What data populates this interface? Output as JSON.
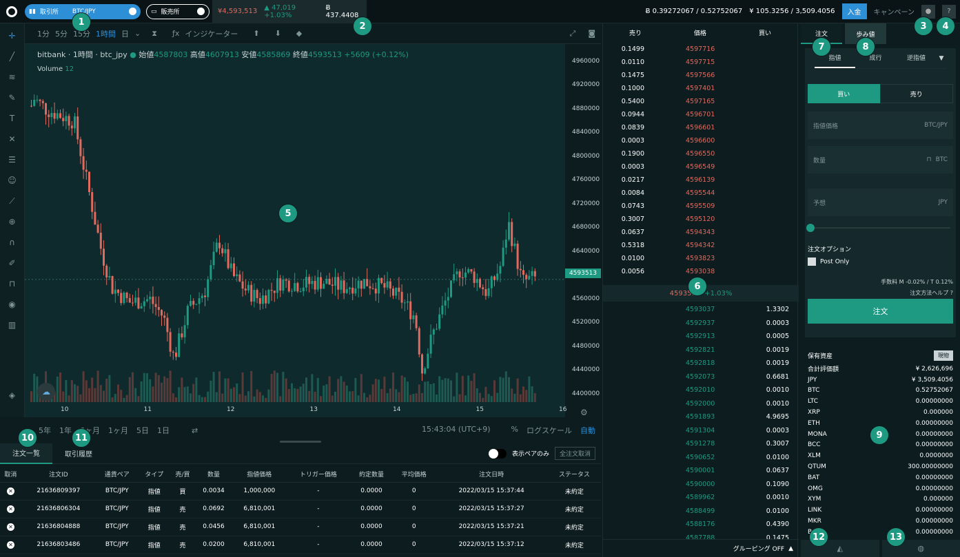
{
  "topbar": {
    "exchange_label": "取引所",
    "pair": "BTC/JPY",
    "shop_label": "販売所",
    "price": "¥4,593,513",
    "change": "47,019 +1.03%",
    "volume": "437.4408",
    "btc_balance": "0.39272067 / 0.52752067",
    "jpy_balance": "¥ 105.3256 / 3,509.4056",
    "deposit": "入金",
    "campaign": "キャンペーン"
  },
  "badges": [
    "1",
    "2",
    "3",
    "4",
    "5",
    "6",
    "7",
    "8",
    "9",
    "10",
    "11",
    "12",
    "13"
  ],
  "chart_header": {
    "intervals": [
      "1分",
      "5分",
      "15分",
      "1時間",
      "日"
    ],
    "active": "1時間",
    "indicator": "インジケーター"
  },
  "legend": {
    "source": "bitbank · 1時間 · btc_jpy",
    "open_label": "始値",
    "open": "4587803",
    "high_label": "高値",
    "high": "4607913",
    "low_label": "安値",
    "low": "4585869",
    "close_label": "終値",
    "close": "4593513",
    "diff": "+5609 (+0.12%)",
    "volume_label": "Volume",
    "volume": "12"
  },
  "chart_data": {
    "type": "candlestick",
    "y_ticks": [
      "4960000",
      "4920000",
      "4880000",
      "4840000",
      "4800000",
      "4760000",
      "4720000",
      "4680000",
      "4640000",
      "4600000",
      "4560000",
      "4520000",
      "4480000",
      "4440000",
      "4400000"
    ],
    "x_ticks": [
      "10",
      "11",
      "12",
      "13",
      "14",
      "15",
      "16"
    ],
    "last_price": "4593513",
    "ylim": [
      4380000,
      4990000
    ]
  },
  "range_bar": {
    "ranges": [
      "5年",
      "1年",
      "6ヶ月",
      "1ヶ月",
      "5日",
      "1日"
    ],
    "time": "15:43:04 (UTC+9)",
    "pct": "%",
    "log": "ログスケール",
    "auto": "自動"
  },
  "orders": {
    "tabs": [
      "注文一覧",
      "取引履歴"
    ],
    "pair_only": "表示ペアのみ",
    "cancel_all": "全注文取消",
    "headers": [
      "取消",
      "注文ID",
      "通貨ペア",
      "タイプ",
      "売/買",
      "数量",
      "指値価格",
      "トリガー価格",
      "約定数量",
      "平均価格",
      "注文日時",
      "ステータス"
    ],
    "rows": [
      {
        "id": "21636809397",
        "pair": "BTC/JPY",
        "type": "指値",
        "side": "買",
        "qty": "0.0034",
        "price": "1,000,000",
        "trigger": "-",
        "filled": "0.0000",
        "avg": "0",
        "date": "2022/03/15 15:37:44",
        "status": "未約定"
      },
      {
        "id": "21636806304",
        "pair": "BTC/JPY",
        "type": "指値",
        "side": "売",
        "qty": "0.0692",
        "price": "6,810,001",
        "trigger": "-",
        "filled": "0.0000",
        "avg": "0",
        "date": "2022/03/15 15:37:27",
        "status": "未約定"
      },
      {
        "id": "21636804888",
        "pair": "BTC/JPY",
        "type": "指値",
        "side": "売",
        "qty": "0.0456",
        "price": "6,810,001",
        "trigger": "-",
        "filled": "0.0000",
        "avg": "0",
        "date": "2022/03/15 15:37:21",
        "status": "未約定"
      },
      {
        "id": "21636803486",
        "pair": "BTC/JPY",
        "type": "指値",
        "side": "売",
        "qty": "0.0200",
        "price": "6,810,001",
        "trigger": "-",
        "filled": "0.0000",
        "avg": "0",
        "date": "2022/03/15 15:37:12",
        "status": "未約定"
      }
    ]
  },
  "orderbook": {
    "headers": [
      "売り",
      "価格",
      "買い"
    ],
    "asks": [
      [
        "0.1499",
        "4597716"
      ],
      [
        "0.0110",
        "4597715"
      ],
      [
        "0.1475",
        "4597566"
      ],
      [
        "0.1000",
        "4597401"
      ],
      [
        "0.5400",
        "4597165"
      ],
      [
        "0.0944",
        "4596701"
      ],
      [
        "0.0839",
        "4596601"
      ],
      [
        "0.0003",
        "4596600"
      ],
      [
        "0.1900",
        "4596550"
      ],
      [
        "0.0003",
        "4596549"
      ],
      [
        "0.0217",
        "4596139"
      ],
      [
        "0.0084",
        "4595544"
      ],
      [
        "0.0743",
        "4595509"
      ],
      [
        "0.3007",
        "4595120"
      ],
      [
        "0.0637",
        "4594343"
      ],
      [
        "0.5318",
        "4594342"
      ],
      [
        "0.0100",
        "4593823"
      ],
      [
        "0.0056",
        "4593038"
      ]
    ],
    "mid_price": "4593513",
    "mid_change": "+1.03%",
    "bids": [
      [
        "4593037",
        "1.3302"
      ],
      [
        "4592937",
        "0.0003"
      ],
      [
        "4592913",
        "0.0005"
      ],
      [
        "4592821",
        "0.0019"
      ],
      [
        "4592818",
        "0.0019"
      ],
      [
        "4592073",
        "0.6681"
      ],
      [
        "4592010",
        "0.0010"
      ],
      [
        "4592000",
        "0.0010"
      ],
      [
        "4591893",
        "4.9695"
      ],
      [
        "4591304",
        "0.0003"
      ],
      [
        "4591278",
        "0.3007"
      ],
      [
        "4590652",
        "0.0100"
      ],
      [
        "4590001",
        "0.0637"
      ],
      [
        "4590000",
        "0.1090"
      ],
      [
        "4589962",
        "0.0010"
      ],
      [
        "4588499",
        "0.0100"
      ],
      [
        "4588176",
        "0.4390"
      ],
      [
        "4587788",
        "0.1475"
      ]
    ],
    "grouping": "グルーピング OFF"
  },
  "order_form": {
    "tabs": [
      "注文",
      "歩み値"
    ],
    "types": [
      "指値",
      "成行",
      "逆指値"
    ],
    "buy": "買い",
    "sell": "売り",
    "limit_price": "指値価格",
    "limit_unit": "BTC/JPY",
    "qty": "数量",
    "qty_unit": "BTC",
    "estimate": "予想",
    "estimate_unit": "JPY",
    "options": "注文オプション",
    "post_only": "Post Only",
    "fee": "手数料 M -0.02% / T 0.12%",
    "help": "注文方法ヘルプ",
    "submit": "注文"
  },
  "assets": {
    "title": "保有資産",
    "button": "現物",
    "rows": [
      [
        "合計評価額",
        "¥ 2,626,696"
      ],
      [
        "JPY",
        "¥ 3,509.4056"
      ],
      [
        "BTC",
        "0.52752067"
      ],
      [
        "LTC",
        "0.00000000"
      ],
      [
        "XRP",
        "0.000000"
      ],
      [
        "ETH",
        "0.00000000"
      ],
      [
        "MONA",
        "0.00000000"
      ],
      [
        "BCC",
        "0.00000000"
      ],
      [
        "XLM",
        "0.0000000"
      ],
      [
        "QTUM",
        "300.00000000"
      ],
      [
        "BAT",
        "0.00000000"
      ],
      [
        "OMG",
        "0.00000000"
      ],
      [
        "XYM",
        "0.000000"
      ],
      [
        "LINK",
        "0.00000000"
      ],
      [
        "MKR",
        "0.00000000"
      ],
      [
        "BOBA",
        "0.00000000"
      ]
    ]
  },
  "colors": {
    "accent": "#1e9a82",
    "sell": "#e06a5e",
    "blue": "#2d8fd6"
  }
}
